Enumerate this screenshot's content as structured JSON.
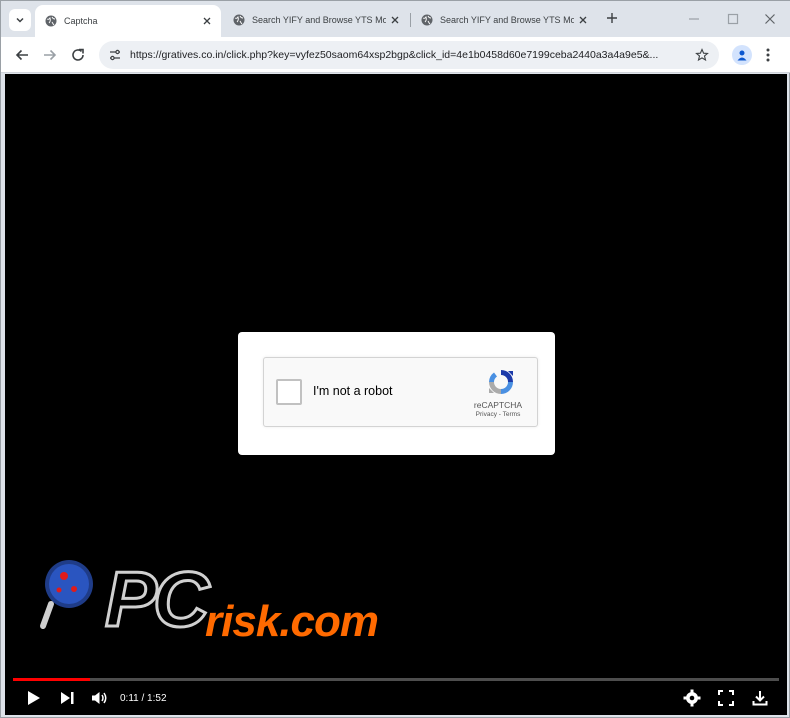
{
  "tabs": [
    {
      "title": "Captcha",
      "active": true
    },
    {
      "title": "Search YIFY and Browse YTS Mo",
      "active": false
    },
    {
      "title": "Search YIFY and Browse YTS Mo",
      "active": false
    }
  ],
  "omnibox": {
    "url": "https://gratives.co.in/click.php?key=vyfez50saom64xsp2bgp&click_id=4e1b0458d60e7199ceba2440a3a4a9e5&..."
  },
  "captcha": {
    "label": "I'm not a robot",
    "brand": "reCAPTCHA",
    "links": "Privacy - Terms"
  },
  "watermark": {
    "pc": "PC",
    "domain": "risk.com"
  },
  "video": {
    "time": "0:11 / 1:52",
    "progress": 0.1
  },
  "colors": {
    "progress": "#ff0000",
    "watermark_accent": "#ff6a00"
  }
}
